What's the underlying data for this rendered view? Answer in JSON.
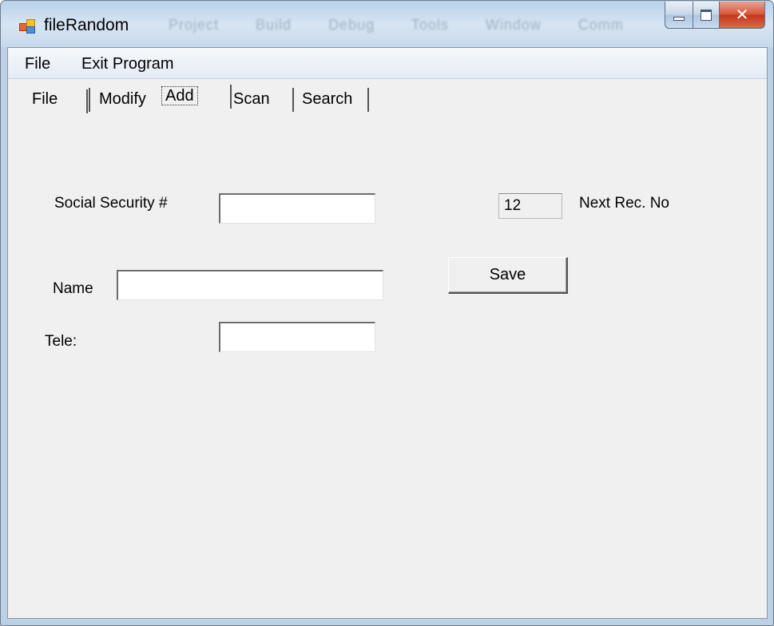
{
  "window": {
    "title": "fileRandom",
    "ghost_menu": [
      "Project",
      "Build",
      "Debug",
      "Tools",
      "Window",
      "Comm"
    ]
  },
  "menubar": {
    "items": [
      "File",
      "Exit Program"
    ]
  },
  "tabs": [
    {
      "label": "File"
    },
    {
      "label": "Modify"
    },
    {
      "label": "Add",
      "active": true
    },
    {
      "label": "Scan"
    },
    {
      "label": "Search"
    }
  ],
  "form": {
    "ssn_label": "Social Security #",
    "ssn_value": "",
    "name_label": "Name",
    "name_value": "",
    "tele_label": "Tele:",
    "tele_value": "",
    "next_rec_value": "12",
    "next_rec_label": "Next Rec. No",
    "save_label": "Save"
  },
  "colors": {
    "title_gradient_top": "#b9d1ea",
    "client_bg": "#f0f0f0",
    "close_button": "#c3361b"
  },
  "icons": [
    "app-icon",
    "minimize-icon",
    "maximize-icon",
    "close-icon"
  ]
}
